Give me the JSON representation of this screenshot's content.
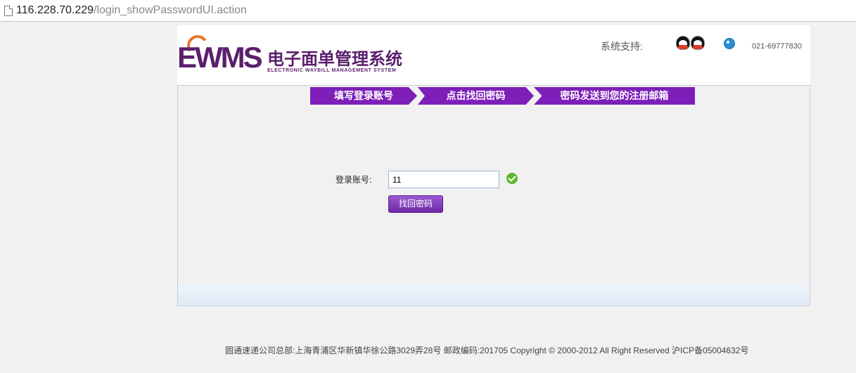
{
  "browser": {
    "url_host": "116.228.70.229",
    "url_path": "/login_showPasswordUI.action"
  },
  "header": {
    "logo_mark": "EWMS",
    "logo_cn": "电子面单管理系统",
    "logo_en": "ELECTRONIC WAYBILL MANAGEMENT SYSTEM",
    "support_label": "系统支持:",
    "phone": "021-69777830",
    "icons": [
      "qq-icon",
      "qq-icon",
      "bird-icon"
    ]
  },
  "steps": [
    "填写登录账号",
    "点击找回密码",
    "密码发送到您的注册邮箱"
  ],
  "form": {
    "account_label": "登录账号:",
    "account_value": "11",
    "submit_label": "找回密码"
  },
  "footer": {
    "text": "圆通速递公司总部:上海青浦区华新镇华徐公路3029弄28号 邮政编码:201705 Copyright © 2000-2012 All Right Reserved 沪ICP备05004632号"
  },
  "colors": {
    "brand_purple": "#7d1fb8",
    "logo_purple": "#5b1f6d",
    "accent_orange": "#e8742a",
    "success_green": "#5cb82f"
  }
}
